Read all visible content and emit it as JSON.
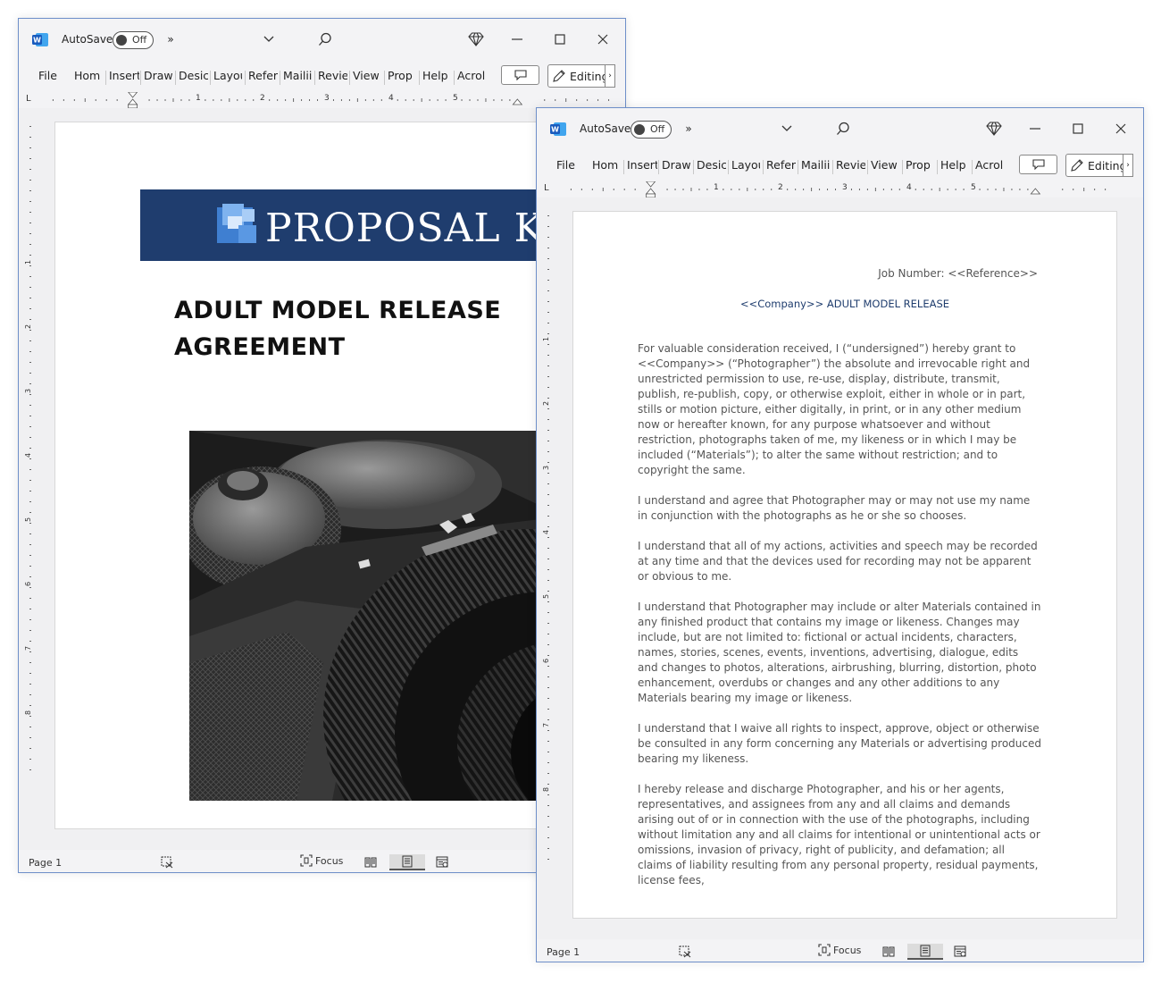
{
  "app": {
    "autosave_label": "AutoSave",
    "autosave_state": "Off",
    "more_commands": "»",
    "ribbon_tabs": [
      "File",
      "Hom",
      "Insert",
      "Draw",
      "Desic",
      "Layou",
      "Refer",
      "Mailii",
      "Revie",
      "View",
      "Prop",
      "Help",
      "Acrol"
    ],
    "editing_label": "Editing",
    "status_page": "Page 1",
    "status_focus": "Focus",
    "ruler_corner": "L",
    "ruler_numbers": [
      "1",
      "2",
      "3",
      "4",
      "5"
    ],
    "vruler_numbers": [
      "1",
      "2",
      "3",
      "4",
      "5",
      "6",
      "7",
      "8"
    ]
  },
  "colors": {
    "banner": "#1f3d6e",
    "window_border": "#6e8fc9",
    "word_blue": "#185abd"
  },
  "cover": {
    "brand": "PROPOSAL KIT",
    "title": "ADULT MODEL RELEASE AGREEMENT"
  },
  "content": {
    "job_number": "Job Number: <<Reference>>",
    "doc_title": "<<Company>> ADULT MODEL RELEASE",
    "paragraphs": [
      "For valuable consideration received, I (“undersigned”) hereby grant to <<Company>> (“Photographer”) the absolute and irrevocable right and unrestricted permission to use, re-use, display, distribute, transmit, publish, re-publish, copy, or otherwise exploit, either in whole or in part, stills or motion picture, either digitally, in print, or in any other medium now or hereafter known, for any purpose whatsoever and without restriction, photographs taken of me, my likeness or in which I may be included (“Materials”); to alter the same without restriction; and to copyright the same.",
      "I understand and agree that Photographer may or may not use my name in conjunction with the photographs as he or she so chooses.",
      "I understand that all of my actions, activities and speech may be recorded at any time and that the devices used for recording may not be apparent or obvious to me.",
      "I understand that Photographer may include or alter Materials contained in any finished product that contains my image or likeness. Changes may include, but are not limited to: fictional or actual incidents, characters, names, stories, scenes, events, inventions, advertising, dialogue, edits and changes to photos, alterations, airbrushing, blurring, distortion, photo enhancement, overdubs or changes and any other additions to any Materials bearing my image or likeness.",
      "I understand that I waive all rights to inspect, approve, object or otherwise be consulted in any form concerning any Materials or advertising produced bearing my likeness.",
      "I hereby release and discharge Photographer, and his or her agents, representatives, and assignees from any and all claims and demands arising out of or in connection with the use of the photographs, including without limitation any and all claims for intentional or unintentional acts or omissions, invasion of privacy, right of publicity, and defamation; all claims of liability resulting from any personal property, residual payments, license fees,"
    ]
  }
}
